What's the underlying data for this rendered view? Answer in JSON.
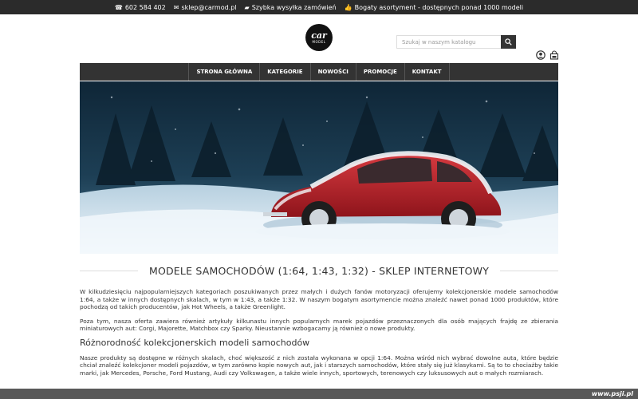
{
  "topbar": {
    "phone": "602 584 402",
    "email": "sklep@carmod.pl",
    "shipping": "Szybka wysyłka zamówień",
    "assortment": "Bogaty asortyment - dostępnych ponad 1000 modeli"
  },
  "logo": {
    "line1": "car",
    "line2": "MODEL"
  },
  "search": {
    "placeholder": "Szukaj w naszym katalogu"
  },
  "nav": {
    "items": [
      {
        "label": "STRONA GŁÓWNA"
      },
      {
        "label": "KATEGORIE"
      },
      {
        "label": "NOWOŚCI"
      },
      {
        "label": "PROMOCJE"
      },
      {
        "label": "KONTAKT"
      }
    ]
  },
  "main": {
    "title": "MODELE SAMOCHODÓW (1:64, 1:43, 1:32) - SKLEP INTERNETOWY",
    "p1": "W kilkudziesięciu najpopularniejszych kategoriach poszukiwanych przez małych i dużych fanów motoryzacji oferujemy kolekcjonerskie modele samochodów 1:64, a także w innych dostępnych skalach, w tym w 1:43, a także 1:32. W naszym bogatym asortymencie można znaleźć nawet ponad 1000 produktów, które pochodzą od takich producentów, jak Hot Wheels, a także Greenlight.",
    "p2": "Poza tym, nasza oferta zawiera również artykuły kilkunastu innych popularnych marek pojazdów przeznaczonych dla osób mających frajdę ze zbierania miniaturowych aut: Corgi, Majorette, Matchbox czy Sparky. Nieustannie wzbogacamy ją również o nowe produkty.",
    "h2": "Różnorodność kolekcjonerskich modeli samochodów",
    "p3": "Nasze produkty są dostępne w różnych skalach, choć większość z nich została wykonana w opcji 1:64. Można wśród nich wybrać dowolne auta, które będzie chciał znaleźć kolekcjoner modeli pojazdów, w tym zarówno kopie nowych aut, jak i starszych samochodów, które stały się już klasykami. Są to to chociażby takie marki, jak Mercedes, Porsche, Ford Mustang, Audi czy Volkswagen, a także wiele innych, sportowych, terenowych czy luksusowych aut o małych rozmiarach."
  },
  "watermark": "www.psji.pl",
  "colors": {
    "topbar": "#2b2b2b",
    "nav": "#333333",
    "car": "#c8202a"
  }
}
